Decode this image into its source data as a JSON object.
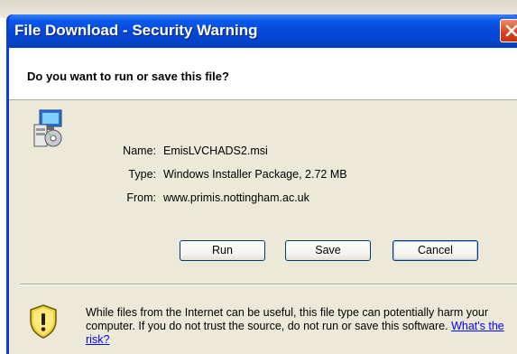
{
  "dialog": {
    "title": "File Download - Security Warning",
    "question": "Do you want to run or save this file?"
  },
  "file": {
    "name_label": "Name:",
    "name_value": "EmisLVCHADS2.msi",
    "type_label": "Type:",
    "type_value": "Windows Installer Package, 2.72 MB",
    "from_label": "From:",
    "from_value": "www.primis.nottingham.ac.uk"
  },
  "buttons": {
    "run_label": "Run",
    "save_label": "Save",
    "cancel_label": "Cancel"
  },
  "warning": {
    "text": "While files from the Internet can be useful, this file type can potentially harm your computer. If you do not trust the source, do not run or save this software.",
    "link_text": "What's the risk?"
  },
  "icons": {
    "close": "close-icon",
    "file": "installer-file-icon",
    "warning": "security-shield-icon"
  },
  "colors": {
    "titlebar": "#0546d8",
    "close_button": "#d9401a",
    "link": "#0000ff",
    "client_bg": "#ece9d8"
  }
}
